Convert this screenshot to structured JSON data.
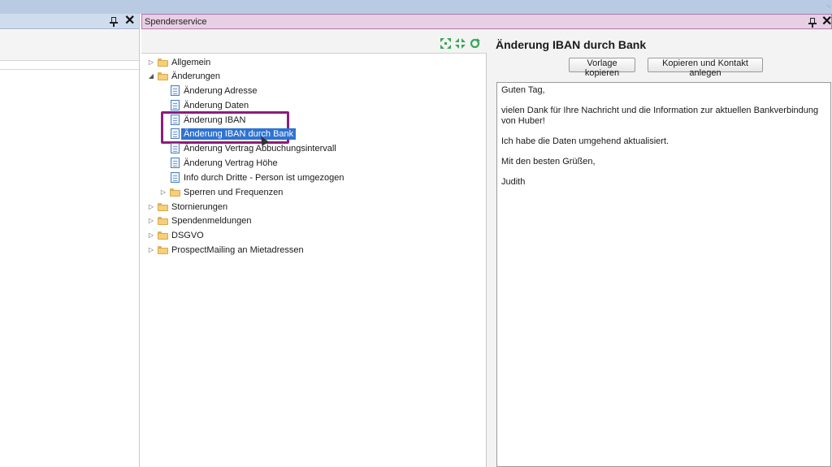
{
  "left_panel": {
    "pin_glyph": "pin-icon",
    "close_glyph": "✕"
  },
  "main_panel": {
    "title": "Spenderservice",
    "close_glyph": "✕",
    "toolbar": [
      "expand-all-icon",
      "collapse-all-icon",
      "refresh-icon"
    ]
  },
  "tree": [
    {
      "label": "Allgemein",
      "type": "folder",
      "expanded": false
    },
    {
      "label": "Änderungen",
      "type": "folder",
      "expanded": true
    },
    {
      "label": "Änderung Adresse",
      "type": "doc"
    },
    {
      "label": "Änderung Daten",
      "type": "doc"
    },
    {
      "label": "Änderung IBAN",
      "type": "doc"
    },
    {
      "label": "Änderung IBAN durch Bank",
      "type": "doc",
      "selected": true
    },
    {
      "label": "Änderung Vertrag Abbuchungsintervall",
      "type": "doc"
    },
    {
      "label": "Änderung Vertrag Höhe",
      "type": "doc"
    },
    {
      "label": "Info durch Dritte - Person ist umgezogen",
      "type": "doc"
    },
    {
      "label": "Sperren und Frequenzen",
      "type": "folder",
      "expanded": false
    },
    {
      "label": "Stornierungen",
      "type": "folder",
      "expanded": false
    },
    {
      "label": "Spendenmeldungen",
      "type": "folder",
      "expanded": false
    },
    {
      "label": "DSGVO",
      "type": "folder",
      "expanded": false
    },
    {
      "label": "ProspectMailing an Mietadressen",
      "type": "folder",
      "expanded": false
    }
  ],
  "detail": {
    "title": "Änderung IBAN durch Bank",
    "buttons": {
      "copy_template": "Vorlage kopieren",
      "copy_and_contact": "Kopieren und Kontakt anlegen"
    },
    "body": [
      "Guten Tag,",
      "vielen Dank für Ihre Nachricht und die Information zur aktuellen Bankverbindung von Huber!",
      "Ich habe die Daten umgehend aktualisiert.",
      "Mit den besten Grüßen,",
      "Judith"
    ]
  },
  "colors": {
    "selection": "#2f73d2",
    "highlight_box": "#8e1d7a",
    "header_tab": "#e7cfe4"
  }
}
